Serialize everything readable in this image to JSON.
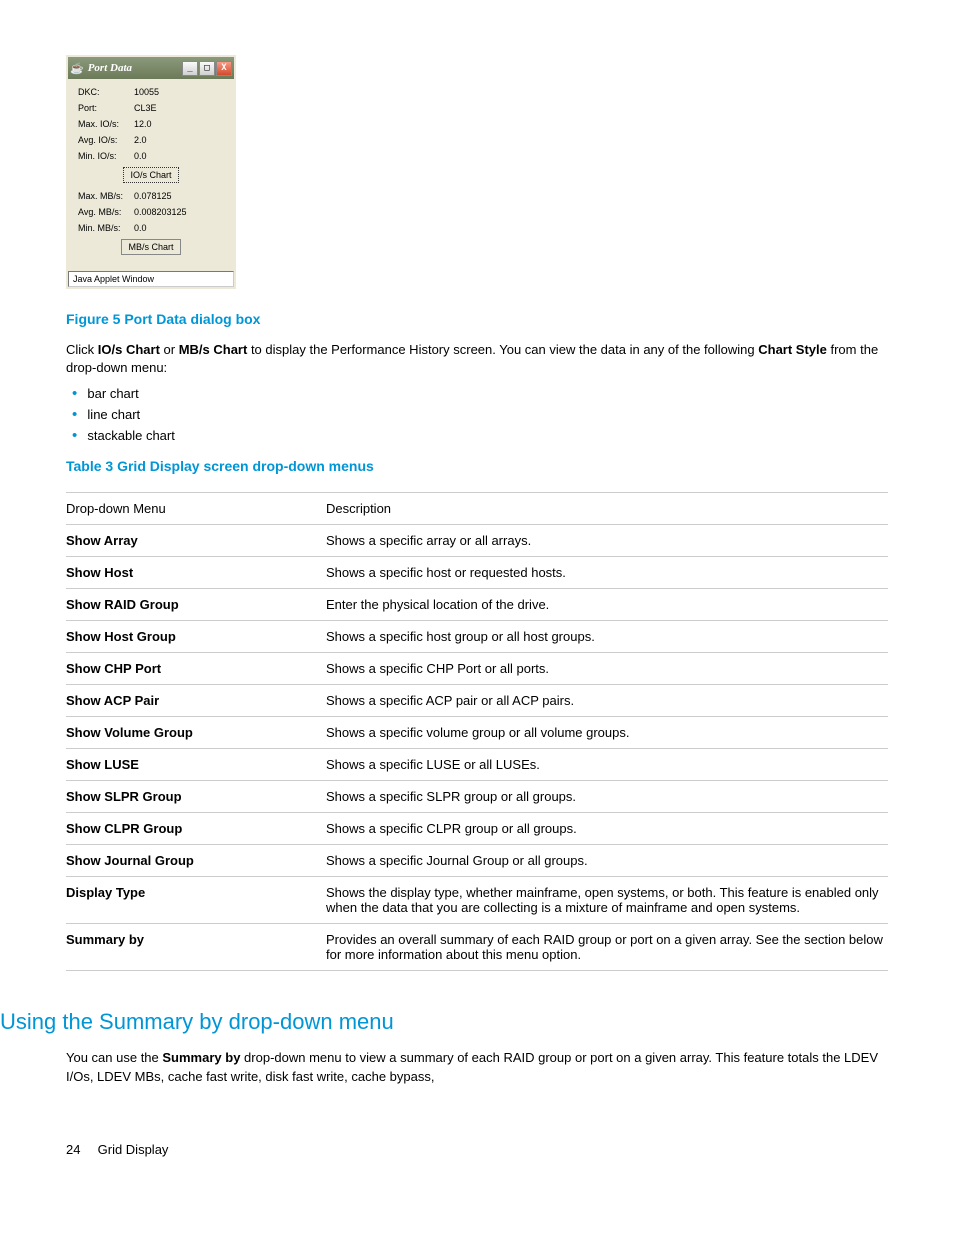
{
  "dialog": {
    "title": "Port Data",
    "rows_io": [
      {
        "label": "DKC:",
        "value": "10055"
      },
      {
        "label": "Port:",
        "value": "CL3E"
      },
      {
        "label": "Max. IO/s:",
        "value": "12.0"
      },
      {
        "label": "Avg. IO/s:",
        "value": "2.0"
      },
      {
        "label": "Min. IO/s:",
        "value": "0.0"
      }
    ],
    "btn_io": "IO/s Chart",
    "rows_mb": [
      {
        "label": "Max. MB/s:",
        "value": "0.078125"
      },
      {
        "label": "Avg. MB/s:",
        "value": "0.008203125"
      },
      {
        "label": "Min. MB/s:",
        "value": "0.0"
      }
    ],
    "btn_mb": "MB/s Chart",
    "status": "Java Applet Window"
  },
  "figure_caption": "Figure 5 Port Data dialog box",
  "para1_a": "Click ",
  "para1_b": "IO/s Chart",
  "para1_c": " or ",
  "para1_d": "MB/s Chart",
  "para1_e": " to display the Performance History screen. You can view the data in any of the following ",
  "para1_f": "Chart Style",
  "para1_g": " from the drop-down menu:",
  "bullets": [
    "bar chart",
    "line chart",
    "stackable chart"
  ],
  "table_caption": "Table 3 Grid Display screen drop-down menus",
  "table_header": {
    "c1": "Drop-down Menu",
    "c2": "Description"
  },
  "table_rows": [
    {
      "c1": "Show Array",
      "c2": "Shows a specific array or all arrays."
    },
    {
      "c1": "Show Host",
      "c2": "Shows a specific host or requested hosts."
    },
    {
      "c1": "Show RAID Group",
      "c2": "Enter the physical location of the drive."
    },
    {
      "c1": "Show Host Group",
      "c2": "Shows a specific host group or all host groups."
    },
    {
      "c1": "Show CHP Port",
      "c2": "Shows a specific CHP Port or all ports."
    },
    {
      "c1": "Show ACP Pair",
      "c2": "Shows a specific ACP pair or all ACP pairs."
    },
    {
      "c1": "Show Volume Group",
      "c2": "Shows a specific volume group or all volume groups."
    },
    {
      "c1": "Show LUSE",
      "c2": "Shows a specific LUSE or all LUSEs."
    },
    {
      "c1": "Show SLPR Group",
      "c2": "Shows a specific SLPR group or all groups."
    },
    {
      "c1": "Show CLPR Group",
      "c2": "Shows a specific CLPR group or all groups."
    },
    {
      "c1": "Show Journal Group",
      "c2": "Shows a specific Journal Group or all groups."
    },
    {
      "c1": "Display Type",
      "c2": "Shows the display type, whether mainframe, open systems, or both. This feature is enabled only when the data that you are collecting is a mixture of mainframe and open systems."
    },
    {
      "c1": "Summary by",
      "c2": "Provides an overall summary of each RAID group or port on a given array. See the section below for more information about this menu option."
    }
  ],
  "section_heading": "Using the Summary by drop-down menu",
  "para2_a": "You can use the ",
  "para2_b": "Summary by",
  "para2_c": " drop-down menu to view a summary of each RAID group or port on a given array. This feature totals the LDEV I/Os, LDEV MBs, cache fast write, disk fast write, cache bypass,",
  "footer": {
    "page": "24",
    "section": "Grid Display"
  }
}
